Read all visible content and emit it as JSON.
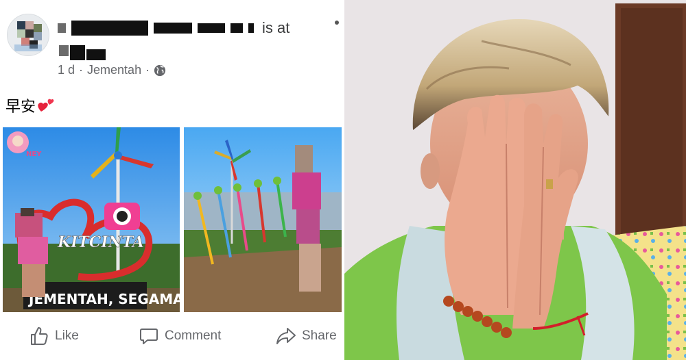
{
  "post": {
    "header_suffix": "is at",
    "timestamp": "1 d",
    "location": "Jementah",
    "separator": "·",
    "caption": "早安",
    "photo_left_sign_text": "JEMENTAH, SEGAMAT",
    "photo_left_heart_text": "KITCINTA",
    "photo_left_badge": "NEY",
    "actions": {
      "like": "Like",
      "comment": "Comment",
      "share": "Share"
    }
  },
  "icons": {
    "globe": "globe-icon",
    "like": "thumbs-up-icon",
    "comment": "speech-bubble-icon",
    "share": "share-arrow-icon",
    "hearts": "hearts-emoji"
  },
  "colors": {
    "text_secondary": "#65676b",
    "text_primary": "#050505",
    "shirt": "#7ec64a",
    "sky": "#4aa3f0"
  }
}
